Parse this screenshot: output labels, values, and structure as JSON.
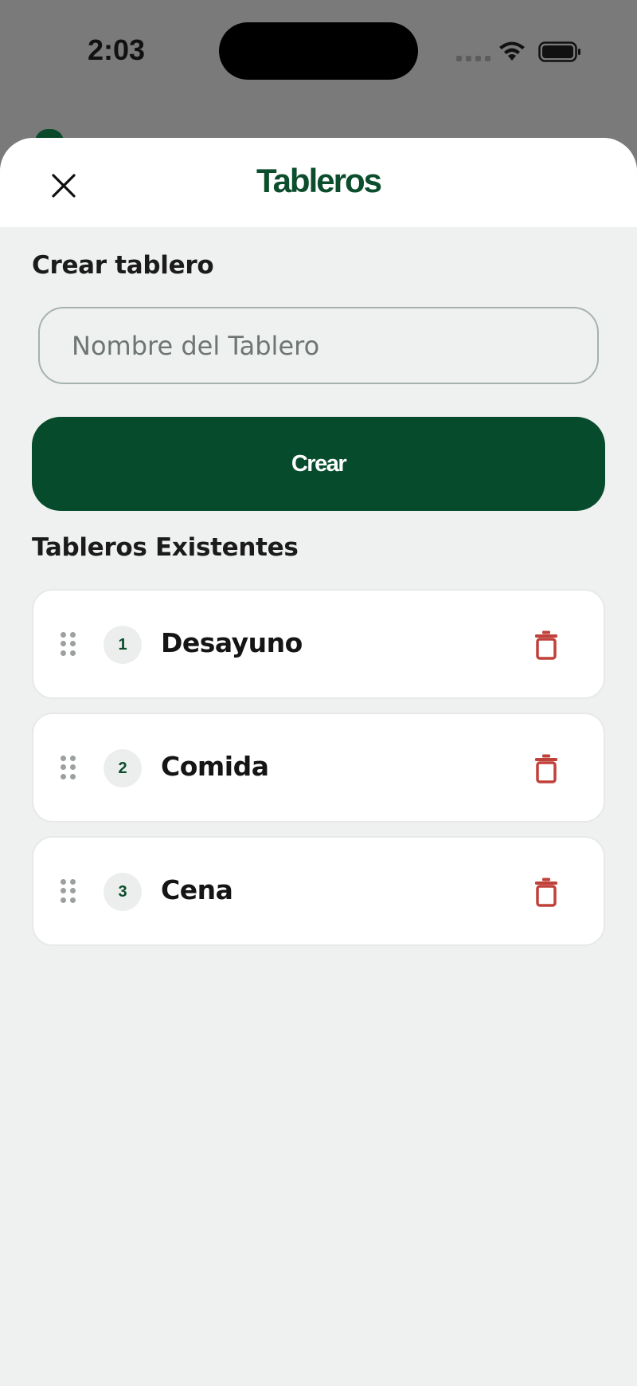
{
  "status_bar": {
    "time": "2:03"
  },
  "colors": {
    "brand_green": "#064c2c",
    "delete_red": "#c0392b",
    "background": "#eff1f0"
  },
  "header": {
    "title": "Tableros",
    "close_icon": "close-icon"
  },
  "create_section": {
    "title": "Crear tablero",
    "input_placeholder": "Nombre del Tablero",
    "input_value": "",
    "button_label": "Crear"
  },
  "existing_section": {
    "title": "Tableros Existentes",
    "boards": [
      {
        "number": "1",
        "name": "Desayuno"
      },
      {
        "number": "2",
        "name": "Comida"
      },
      {
        "number": "3",
        "name": "Cena"
      }
    ]
  }
}
